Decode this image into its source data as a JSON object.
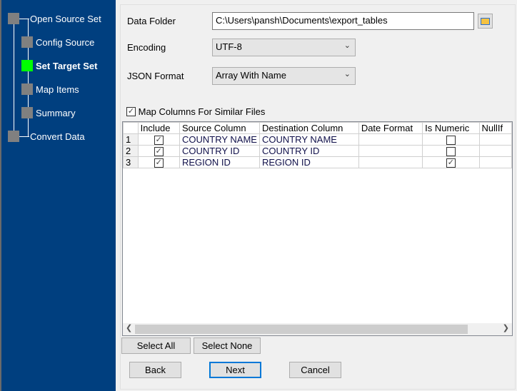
{
  "wizard_steps": [
    {
      "label": "Open Source Set",
      "state": "done"
    },
    {
      "label": "Config Source",
      "state": "done"
    },
    {
      "label": "Set Target Set",
      "state": "current"
    },
    {
      "label": "Map Items",
      "state": "pending"
    },
    {
      "label": "Summary",
      "state": "pending"
    },
    {
      "label": "Convert Data",
      "state": "pending"
    }
  ],
  "colors": {
    "sidebar": "#003f7f",
    "current_step": "#00ff00",
    "step_square": "#808080"
  },
  "form": {
    "data_folder_label": "Data Folder",
    "data_folder_value": "C:\\Users\\pansh\\Documents\\export_tables",
    "encoding_label": "Encoding",
    "encoding_value": "UTF-8",
    "json_format_label": "JSON Format",
    "json_format_value": "Array With Name",
    "map_columns_label": "Map Columns For Similar Files",
    "map_columns_checked": true
  },
  "grid": {
    "headers": [
      "Include",
      "Source Column",
      "Destination Column",
      "Date Format",
      "Is Numeric",
      "NullIf"
    ],
    "rows": [
      {
        "num": "1",
        "include": true,
        "source": "COUNTRY NAME",
        "dest": "COUNTRY NAME",
        "date_format": "",
        "numeric": false,
        "nullif": ""
      },
      {
        "num": "2",
        "include": true,
        "source": "COUNTRY ID",
        "dest": "COUNTRY ID",
        "date_format": "",
        "numeric": false,
        "nullif": ""
      },
      {
        "num": "3",
        "include": true,
        "source": "REGION ID",
        "dest": "REGION ID",
        "date_format": "",
        "numeric": true,
        "nullif": ""
      }
    ]
  },
  "buttons": {
    "select_all": "Select All",
    "select_none": "Select None",
    "back": "Back",
    "next": "Next",
    "cancel": "Cancel"
  }
}
